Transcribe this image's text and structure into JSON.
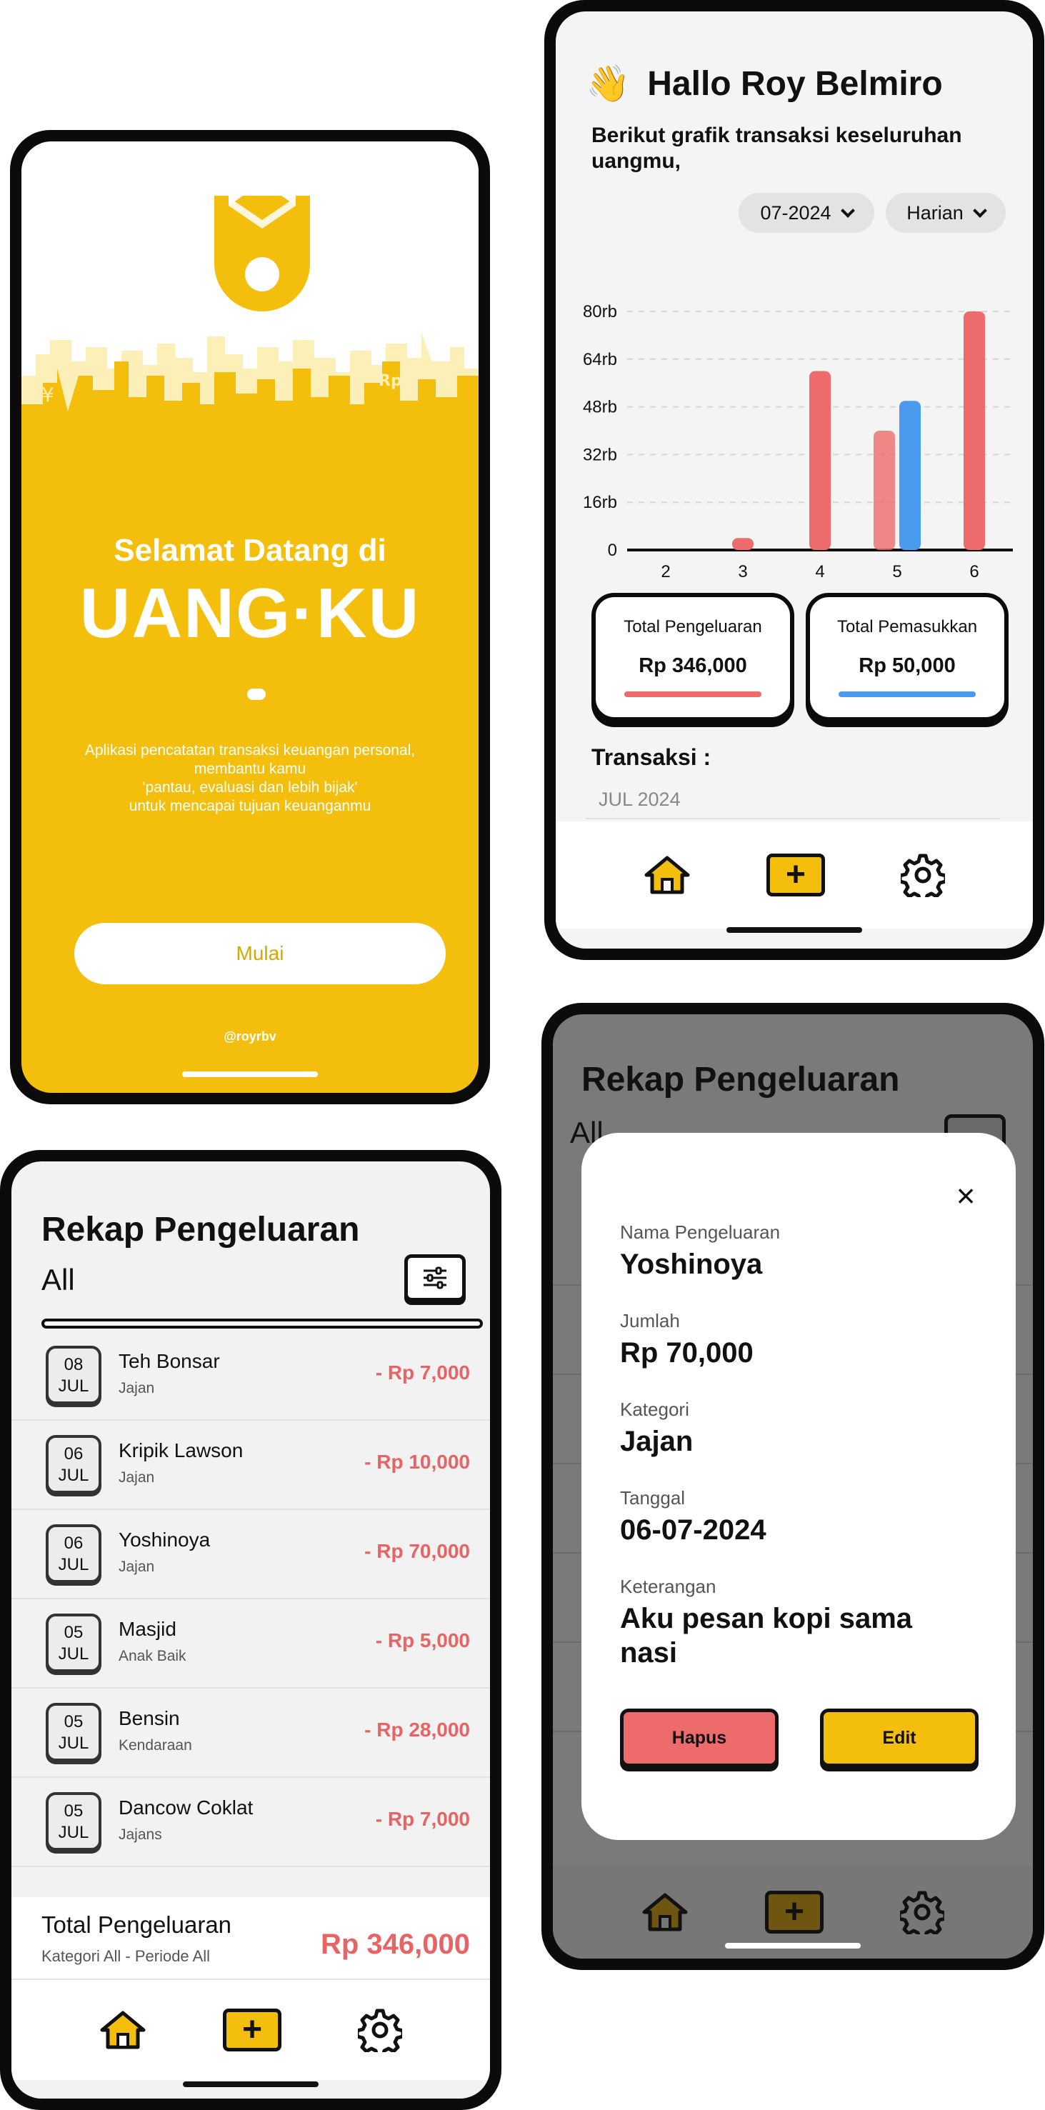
{
  "welcome": {
    "greeting": "Selamat Datang di",
    "brand": "UANG·KU",
    "description": "Aplikasi pencatatan transaksi keuangan personal,\nmembantu kamu\n'pantau, evaluasi dan lebih bijak'\nuntuk mencapai tujuan keuanganmu",
    "start_button": "Mulai",
    "handle": "@royrbv",
    "brand_color": "#F4BE0C"
  },
  "dashboard": {
    "hand_emoji": "👋",
    "greeting": "Hallo Roy Belmiro",
    "subtitle": "Berikut grafik transaksi keseluruhan uangmu,",
    "month_filter": "07-2024",
    "period_filter": "Harian",
    "total_expense_label": "Total Pengeluaran",
    "total_expense_value": "Rp 346,000",
    "total_income_label": "Total Pemasukkan",
    "total_income_value": "Rp 50,000",
    "transactions_label": "Transaksi :",
    "month_header": "JUL 2024",
    "expense_color": "#EE6B6B",
    "income_color": "#4A9BF0"
  },
  "chart_data": {
    "type": "bar",
    "categories": [
      "2",
      "3",
      "4",
      "5",
      "6"
    ],
    "y_ticks": [
      "0",
      "16rb",
      "32rb",
      "48rb",
      "64rb",
      "80rb"
    ],
    "ylim": [
      0,
      80000
    ],
    "grid": true,
    "series": [
      {
        "values": [
          0,
          4000,
          60000,
          40000,
          80000
        ],
        "color": "#EE6B6B"
      },
      {
        "values": [
          0,
          0,
          0,
          50000,
          0
        ],
        "color": "#4A9BF0"
      }
    ]
  },
  "recap": {
    "title": "Rekap Pengeluaran",
    "filter_label": "All",
    "items": [
      {
        "day": "08",
        "month": "JUL",
        "name": "Teh Bonsar",
        "category": "Jajan",
        "amount": "- Rp 7,000"
      },
      {
        "day": "06",
        "month": "JUL",
        "name": "Kripik Lawson",
        "category": "Jajan",
        "amount": "- Rp 10,000"
      },
      {
        "day": "06",
        "month": "JUL",
        "name": "Yoshinoya",
        "category": "Jajan",
        "amount": "- Rp 70,000"
      },
      {
        "day": "05",
        "month": "JUL",
        "name": "Masjid",
        "category": "Anak Baik",
        "amount": "- Rp 5,000"
      },
      {
        "day": "05",
        "month": "JUL",
        "name": "Bensin",
        "category": "Kendaraan",
        "amount": "- Rp 28,000"
      },
      {
        "day": "05",
        "month": "JUL",
        "name": "Dancow Coklat",
        "category": "Jajans",
        "amount": "- Rp 7,000"
      }
    ],
    "footer_title": "Total Pengeluaran",
    "footer_subtitle": "Kategori All - Periode All",
    "footer_total": "Rp 346,000"
  },
  "detail": {
    "bg_title": "Rekap Pengeluaran",
    "bg_all": "All",
    "close_symbol": "×",
    "name_label": "Nama Pengeluaran",
    "name_value": "Yoshinoya",
    "amount_label": "Jumlah",
    "amount_value": "Rp 70,000",
    "category_label": "Kategori",
    "category_value": "Jajan",
    "date_label": "Tanggal",
    "date_value": "06-07-2024",
    "note_label": "Keterangan",
    "note_value": "Aku pesan kopi sama nasi",
    "delete_button": "Hapus",
    "edit_button": "Edit",
    "delete_color": "#EE6B6B"
  },
  "nav": {
    "add_symbol": "+"
  }
}
